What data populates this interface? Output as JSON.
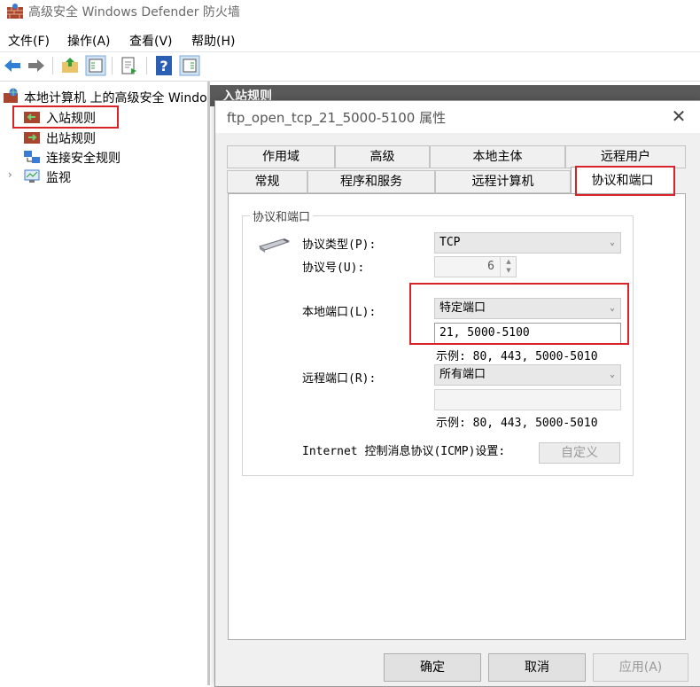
{
  "window": {
    "title": "高级安全 Windows Defender 防火墙"
  },
  "menu": [
    "文件(F)",
    "操作(A)",
    "查看(V)",
    "帮助(H)"
  ],
  "toolbar": {
    "icons": [
      "back-arrow-icon",
      "forward-arrow-icon",
      "up-folder-icon",
      "show-hide-tree-icon",
      "export-list-icon",
      "help-icon",
      "show-hide-action-pane-icon"
    ]
  },
  "tree": {
    "root": "本地计算机 上的高级安全 Windo",
    "items": [
      "入站规则",
      "出站规则",
      "连接安全规则",
      "监视"
    ]
  },
  "background": {
    "header": "入站规则"
  },
  "dialog": {
    "title": "ftp_open_tcp_21_5000-5100 属性",
    "tabs_row1": [
      "作用域",
      "高级",
      "本地主体",
      "远程用户"
    ],
    "tabs_row2": [
      "常规",
      "程序和服务",
      "远程计算机",
      "协议和端口"
    ],
    "group_title": "协议和端口",
    "protocol_type_label": "协议类型(P):",
    "protocol_type_value": "TCP",
    "protocol_number_label": "协议号(U):",
    "protocol_number_value": "6",
    "local_port_label": "本地端口(L):",
    "local_port_mode": "特定端口",
    "local_port_value": "21, 5000-5100",
    "local_port_hint": "示例: 80, 443, 5000-5010",
    "remote_port_label": "远程端口(R):",
    "remote_port_mode": "所有端口",
    "remote_port_value": "",
    "remote_port_hint": "示例: 80, 443, 5000-5010",
    "icmp_label": "Internet 控制消息协议(ICMP)设置:",
    "customize_button": "自定义",
    "ok_button": "确定",
    "cancel_button": "取消",
    "apply_button": "应用(A)"
  },
  "colors": {
    "highlight": "#d9232b",
    "active_tab": "#ffffff"
  }
}
